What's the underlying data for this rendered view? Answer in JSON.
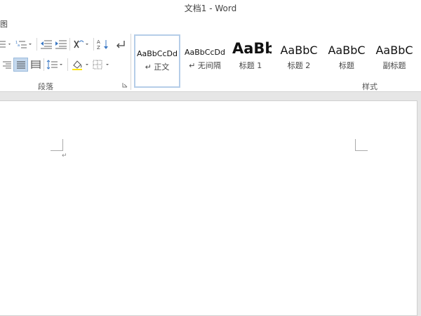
{
  "window": {
    "title": "文档1 - Word",
    "menu_fragment": "图"
  },
  "ribbon": {
    "paragraph_group_label": "段落",
    "styles_group_label": "样式",
    "styles": [
      {
        "preview": "AaBbCcDd",
        "name": "↵ 正文",
        "selected": true
      },
      {
        "preview": "AaBbCcDd",
        "name": "↵ 无间隔",
        "selected": false
      },
      {
        "preview": "AaBb",
        "name": "标题 1",
        "selected": false
      },
      {
        "preview": "AaBbC",
        "name": "标题 2",
        "selected": false
      },
      {
        "preview": "AaBbC",
        "name": "标题",
        "selected": false
      },
      {
        "preview": "AaBbC",
        "name": "副标题",
        "selected": false
      }
    ],
    "icons": {
      "bullets": "bullets-icon",
      "multilevel": "multilevel-list-icon",
      "decrease_indent": "decrease-indent-icon",
      "increase_indent": "increase-indent-icon",
      "chinese_layout": "chinese-layout-icon",
      "sort": "sort-icon",
      "show_marks": "show-formatting-marks-icon",
      "align_right": "align-right-icon",
      "justify": "justify-icon",
      "distributed": "distributed-align-icon",
      "line_spacing": "line-spacing-icon",
      "shading": "shading-icon",
      "borders": "borders-icon",
      "dialog_launcher": "dialog-launcher-icon"
    },
    "selected_alignment": "justify"
  },
  "document": {
    "paragraph_mark": "↵",
    "content": ""
  },
  "colors": {
    "accent": "#2b579a",
    "selected_bg": "#c5d9ee",
    "page": "#ffffff",
    "canvas": "#e6e6e6"
  }
}
